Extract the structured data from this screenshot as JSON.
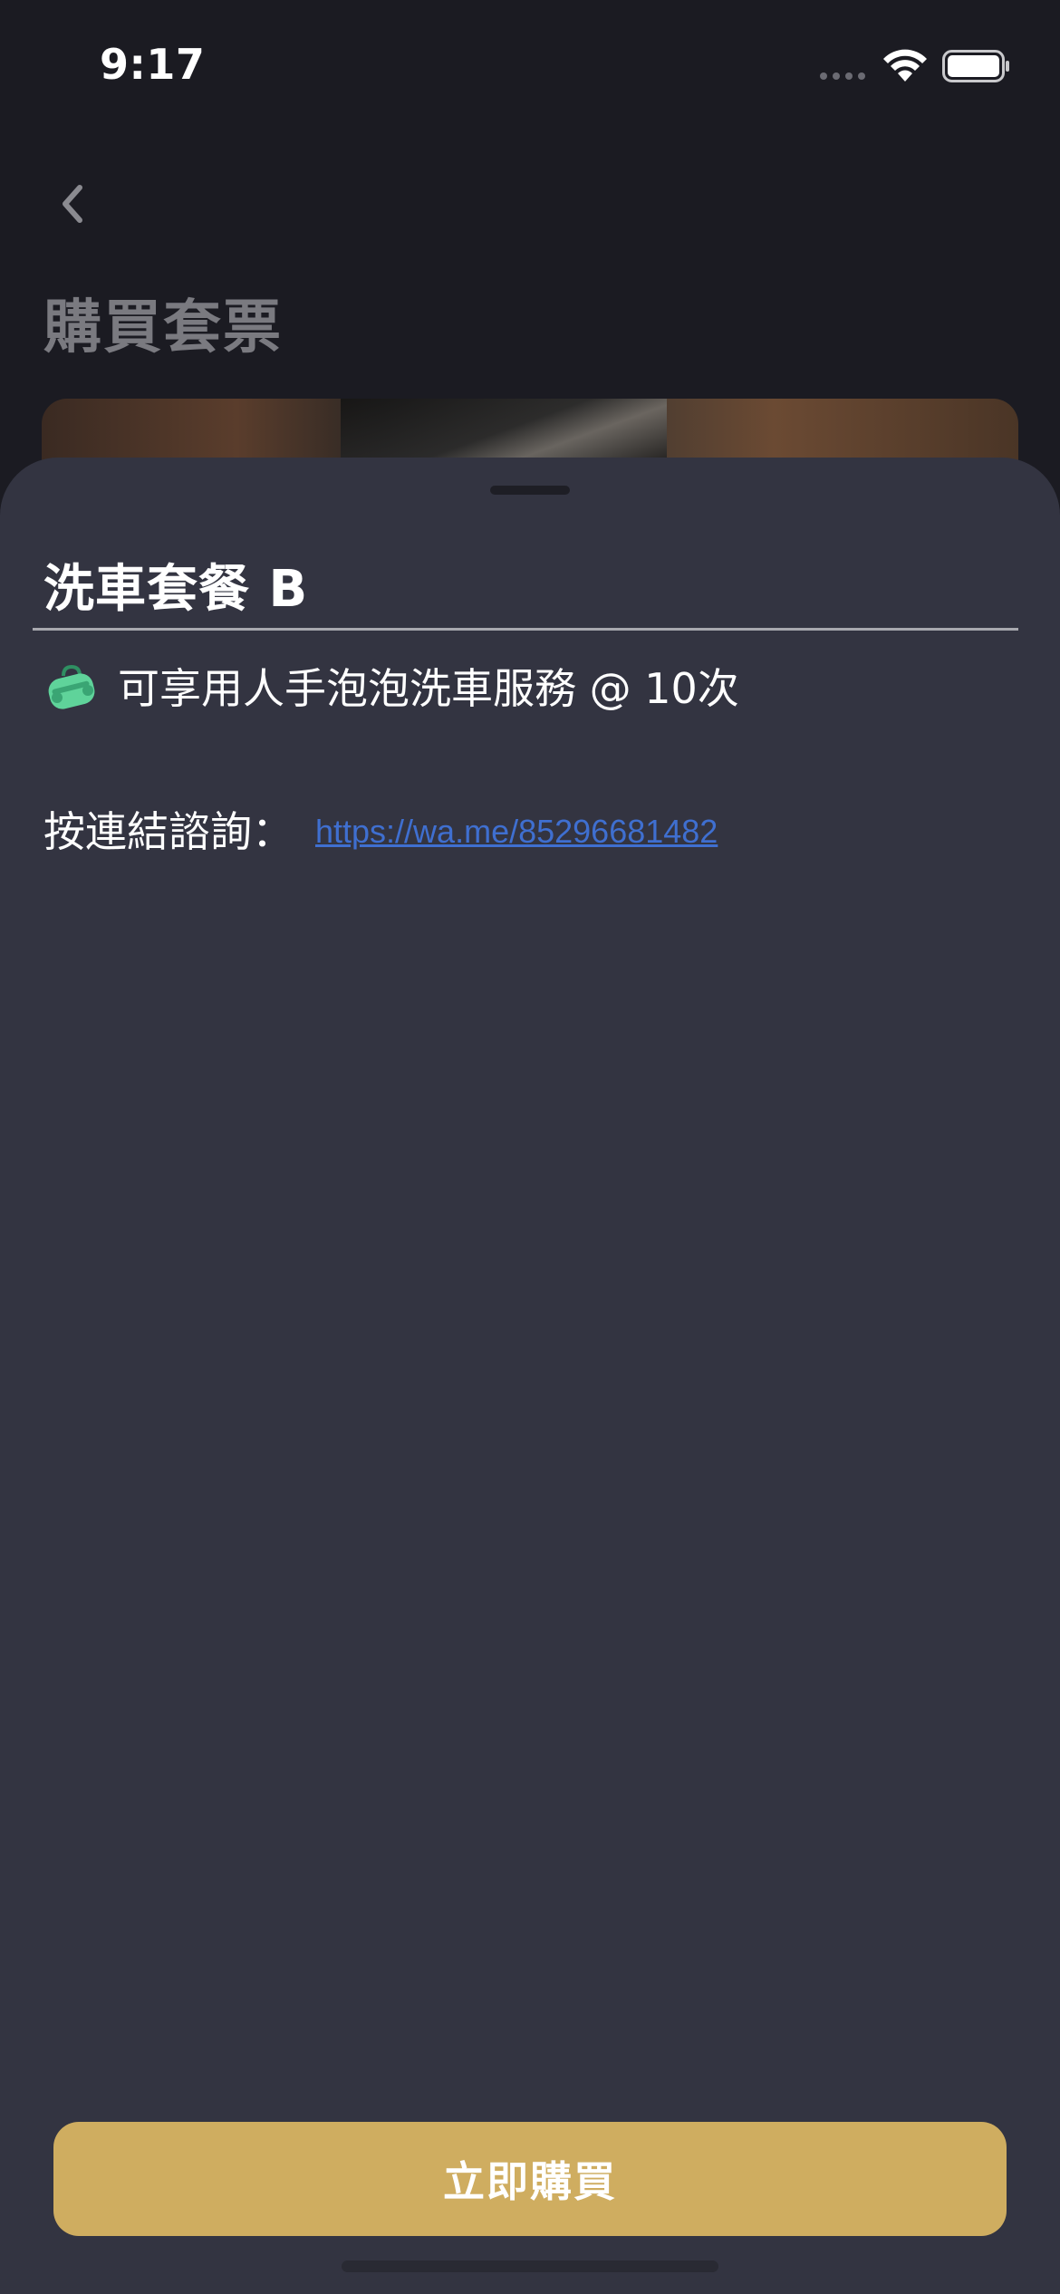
{
  "status_bar": {
    "time": "9:17"
  },
  "header": {
    "title": "購買套票"
  },
  "sheet": {
    "title": "洗車套餐 B",
    "feature_text": "可享用人手泡泡洗車服務 @ 10次",
    "inquiry_label": "按連結諮詢：",
    "inquiry_link": "https://wa.me/85296681482",
    "buy_button_label": "立即購買"
  },
  "colors": {
    "sheet_background": "#333441",
    "accent": "#cfad60",
    "link": "#3f6fd0"
  },
  "icons": {
    "back": "chevron-left-icon",
    "feature": "duffel-bag-icon"
  }
}
